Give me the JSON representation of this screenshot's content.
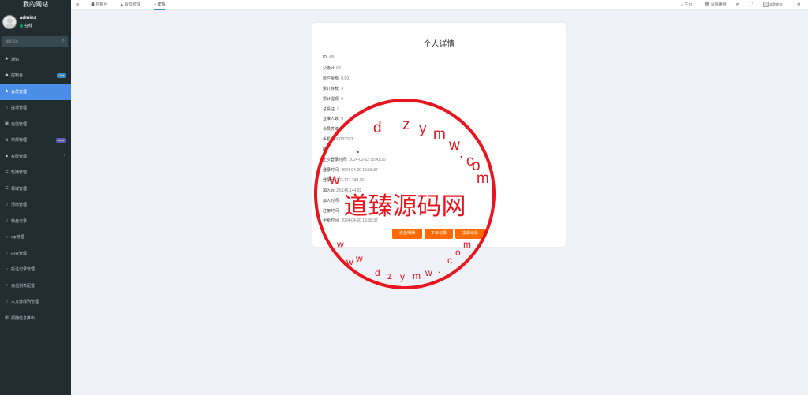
{
  "sidebar": {
    "brand": "我的网站",
    "user": {
      "name": "admins",
      "status": "在线"
    },
    "search_placeholder": "搜索菜单",
    "items": [
      {
        "icon": "✱",
        "label": "通知"
      },
      {
        "icon": "☗",
        "label": "控制台",
        "badge": "hot"
      },
      {
        "icon": "♟",
        "label": "会员管理",
        "active": true
      },
      {
        "icon": "○",
        "label": "提现管理"
      },
      {
        "icon": "▦",
        "label": "充值管理"
      },
      {
        "icon": "⚙",
        "label": "常规管理",
        "badge": "new"
      },
      {
        "icon": "♟",
        "label": "权限管理",
        "chevron": "‹"
      },
      {
        "icon": "☰",
        "label": "轮播管理"
      },
      {
        "icon": "☰",
        "label": "领域管理"
      },
      {
        "icon": "○",
        "label": "活动管理"
      },
      {
        "icon": "○",
        "label": "转盘记录"
      },
      {
        "icon": "○",
        "label": "vip管理"
      },
      {
        "icon": "○",
        "label": "内容管理"
      },
      {
        "icon": "○",
        "label": "投注记录管理"
      },
      {
        "icon": "○",
        "label": "充值列表配置"
      },
      {
        "icon": "○",
        "label": "三方游戏列管理"
      },
      {
        "icon": "▥",
        "label": "报随信息推出"
      }
    ]
  },
  "topbar": {
    "menu_icon": "≡",
    "tabs": [
      {
        "icon": "☗",
        "label": "控制台"
      },
      {
        "icon": "♟",
        "label": "会员管理"
      },
      {
        "icon": "○",
        "label": "详情"
      }
    ],
    "right": {
      "home": "主页",
      "clear_cache": "清除缓存",
      "user": "admins"
    }
  },
  "detail": {
    "title": "个人详情",
    "fields": [
      {
        "label": "ID:",
        "value": "68"
      },
      {
        "label": "父级id:",
        "value": "68"
      },
      {
        "label": "账户余额:",
        "value": "0.00"
      },
      {
        "label": "累计存款:",
        "value": "0"
      },
      {
        "label": "累计提现:",
        "value": "0"
      },
      {
        "label": "总投注:",
        "value": "0"
      },
      {
        "label": "直推人数:",
        "value": "0"
      },
      {
        "label": "会员等级:",
        "value": ""
      },
      {
        "label": "手机:",
        "value": "133333333"
      },
      {
        "label": "邮",
        "value": ""
      },
      {
        "label": "上次登录时间:",
        "value": "2024-02-22 15:41:25"
      },
      {
        "label": "登录时间:",
        "value": "2024-04-20 16:58:37"
      },
      {
        "label": "登录ip:",
        "value": "103.177.249.161"
      },
      {
        "label": "加入ip:",
        "value": "23.146.144.92"
      },
      {
        "label": "加入时间:",
        "value": ""
      },
      {
        "label": "注册时间:",
        "value": ""
      },
      {
        "label": "更新时间:",
        "value": "2024-04-20 16:58:37"
      }
    ],
    "buttons": [
      "资金明细",
      "下单记录",
      "提现记录"
    ]
  },
  "watermark": {
    "center_text": "道臻源码网",
    "top_letters": [
      "w",
      ".",
      "d",
      "z",
      "y",
      "m",
      "w",
      ".",
      "c",
      "o",
      "m"
    ],
    "bottom_text": "w w w . d z y m w . c o m",
    "color": "#e8141e"
  }
}
